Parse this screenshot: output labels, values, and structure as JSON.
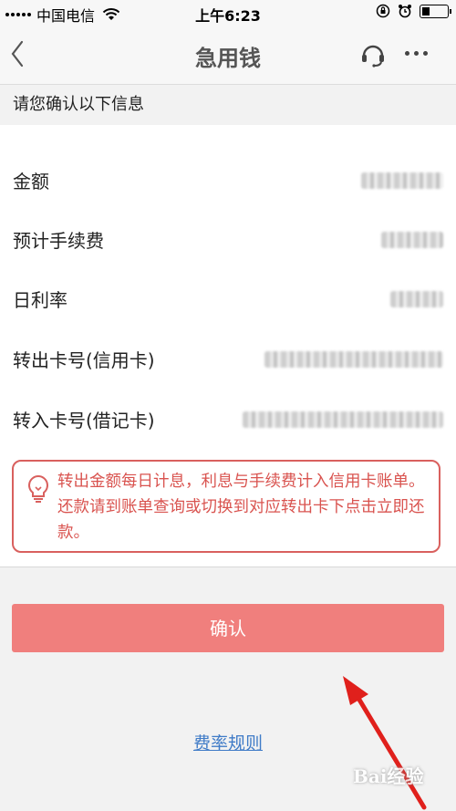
{
  "status_bar": {
    "carrier": "中国电信",
    "time": "上午6:23"
  },
  "nav": {
    "title": "急用钱"
  },
  "section_header": "请您确认以下信息",
  "details": [
    {
      "label": "金额"
    },
    {
      "label": "预计手续费"
    },
    {
      "label": "日利率"
    },
    {
      "label": "转出卡号(信用卡)"
    },
    {
      "label": "转入卡号(借记卡)"
    }
  ],
  "notice": {
    "text": "转出金额每日计息，利息与手续费计入信用卡账单。还款请到账单查询或切换到对应转出卡下点击立即还款。"
  },
  "confirm_button": "确认",
  "rate_rules_link": "费率规则",
  "watermark": "Bai经验",
  "colors": {
    "accent": "#f07f7d",
    "notice_border": "#d9605e",
    "notice_text": "#d9534f",
    "link": "#3f7bc7",
    "annotation_arrow": "#e0201c"
  }
}
